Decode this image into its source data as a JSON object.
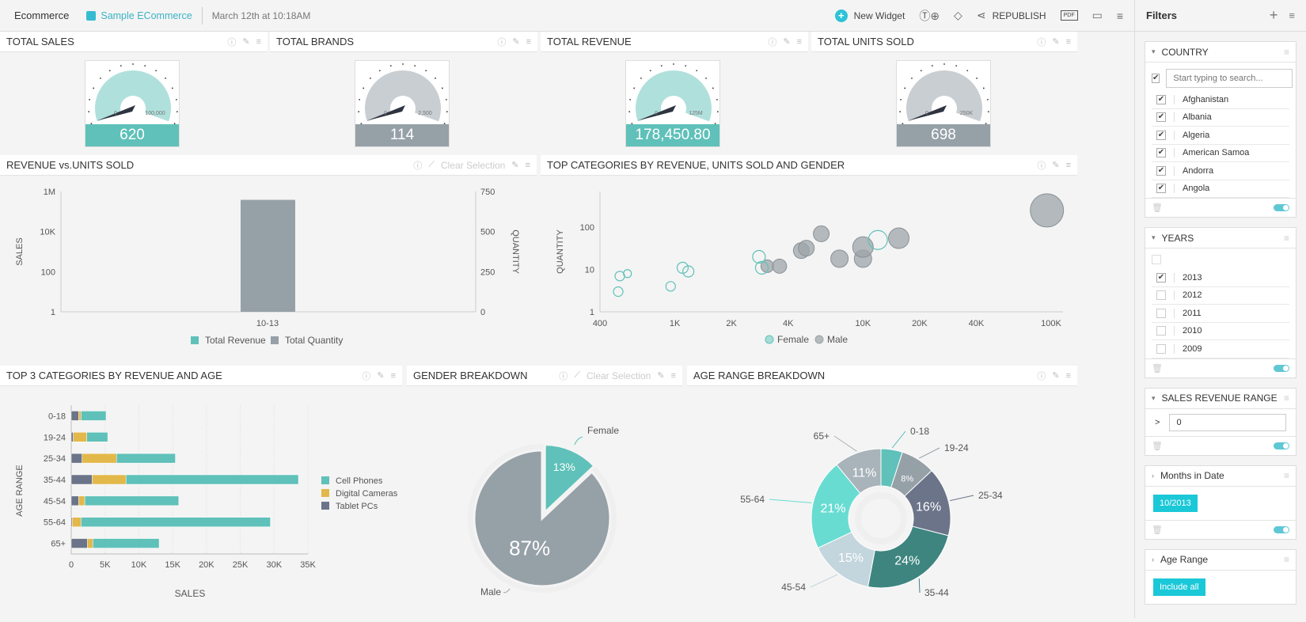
{
  "topbar": {
    "app": "Ecommerce",
    "crumb": "Sample ECommerce",
    "date": "March 12th at 10:18AM",
    "new_widget": "New Widget",
    "republish": "REPUBLISH",
    "pdf": "PDF"
  },
  "kpis": [
    {
      "title": "TOTAL SALES",
      "value": "620",
      "min": "0",
      "max": "100,000",
      "color": "#5fc1b9",
      "fill": "#b0e0dc"
    },
    {
      "title": "TOTAL BRANDS",
      "value": "114",
      "min": "0",
      "max": "2,500",
      "color": "#96a0a7",
      "fill": "#c9ced2"
    },
    {
      "title": "TOTAL REVENUE",
      "value": "178,450.80",
      "min": "0",
      "max": "125M",
      "color": "#5fc1b9",
      "fill": "#b0e0dc"
    },
    {
      "title": "TOTAL UNITS SOLD",
      "value": "698",
      "min": "0",
      "max": "250K",
      "color": "#96a0a7",
      "fill": "#c9ced2"
    }
  ],
  "widgets": {
    "rev_units": {
      "title": "REVENUE vs.UNITS SOLD",
      "clear": "Clear Selection"
    },
    "top_cat": {
      "title": "TOP CATEGORIES BY REVENUE, UNITS SOLD AND GENDER"
    },
    "top3": {
      "title": "TOP 3 CATEGORIES BY REVENUE AND AGE"
    },
    "gender": {
      "title": "GENDER BREAKDOWN",
      "clear": "Clear Selection"
    },
    "age": {
      "title": "AGE RANGE BREAKDOWN"
    }
  },
  "chart_data": [
    {
      "type": "bar",
      "title": "REVENUE vs.UNITS SOLD",
      "categories": [
        "10-13"
      ],
      "series": [
        {
          "name": "Total Revenue",
          "axis": "left",
          "values": [
            178450.8
          ],
          "color": "#5fc1b9"
        },
        {
          "name": "Total Quantity",
          "axis": "right",
          "values": [
            698
          ],
          "color": "#96a0a7"
        }
      ],
      "ylabel": "SALES",
      "y2label": "QUANTITY",
      "yticks": [
        "1",
        "100",
        "10K",
        "1M"
      ],
      "y2ticks": [
        "0",
        "250",
        "500",
        "750"
      ],
      "y2lim": [
        0,
        750
      ],
      "legend": "bottom"
    },
    {
      "type": "scatter",
      "title": "TOP CATEGORIES BY REVENUE, UNITS SOLD AND GENDER",
      "xlabel": "",
      "ylabel": "QUANTITY",
      "xticks": [
        "400",
        "1K",
        "2K",
        "4K",
        "10K",
        "20K",
        "40K",
        "100K"
      ],
      "yticks": [
        "1",
        "10",
        "100"
      ],
      "xscale": "log",
      "yscale": "log",
      "series": [
        {
          "name": "Female",
          "color": "#5fc1b9",
          "points": [
            [
              500,
              3,
              6
            ],
            [
              510,
              7,
              6
            ],
            [
              560,
              8,
              5
            ],
            [
              950,
              4,
              6
            ],
            [
              1100,
              11,
              7
            ],
            [
              1180,
              9,
              7
            ],
            [
              2800,
              20,
              8
            ],
            [
              2900,
              11,
              8
            ],
            [
              12000,
              50,
              12
            ]
          ]
        },
        {
          "name": "Male",
          "color": "#9ea5aa",
          "points": [
            [
              3100,
              12,
              8
            ],
            [
              3600,
              12,
              9
            ],
            [
              4700,
              28,
              10
            ],
            [
              5000,
              32,
              10
            ],
            [
              6000,
              70,
              10
            ],
            [
              7500,
              18,
              11
            ],
            [
              10000,
              18,
              11
            ],
            [
              10000,
              34,
              13
            ],
            [
              15500,
              55,
              13
            ],
            [
              95000,
              250,
              21
            ]
          ]
        }
      ],
      "legend": "bottom"
    },
    {
      "type": "bar",
      "orientation": "horizontal",
      "stacked": true,
      "title": "TOP 3 CATEGORIES BY REVENUE AND AGE",
      "xlabel": "SALES",
      "ylabel": "AGE RANGE",
      "categories": [
        "0-18",
        "19-24",
        "25-34",
        "35-44",
        "45-54",
        "55-64",
        "65+"
      ],
      "xticks": [
        "0",
        "5K",
        "10K",
        "15K",
        "20K",
        "25K",
        "30K",
        "35K"
      ],
      "xlim": [
        0,
        35000
      ],
      "series": [
        {
          "name": "Tablet PCs",
          "color": "#6b7489",
          "values": [
            1100,
            300,
            1600,
            3100,
            1100,
            150,
            2400
          ]
        },
        {
          "name": "Digital Cameras",
          "color": "#e3b84a",
          "values": [
            350,
            2000,
            5100,
            5000,
            900,
            1300,
            800
          ]
        },
        {
          "name": "Cell Phones",
          "color": "#5fc1b9",
          "values": [
            3700,
            3100,
            8700,
            25500,
            13900,
            28000,
            9800
          ]
        }
      ],
      "legend_order": [
        "Cell Phones",
        "Digital Cameras",
        "Tablet PCs"
      ],
      "legend": "right"
    },
    {
      "type": "pie",
      "title": "GENDER BREAKDOWN",
      "slices": [
        {
          "label": "Female",
          "value": 13,
          "text": "13%",
          "color": "#5fc1b9"
        },
        {
          "label": "Male",
          "value": 87,
          "text": "87%",
          "color": "#96a0a7"
        }
      ]
    },
    {
      "type": "pie",
      "donut": true,
      "title": "AGE RANGE BREAKDOWN",
      "slices": [
        {
          "label": "0-18",
          "value": 5,
          "text": "",
          "color": "#5fc1b9"
        },
        {
          "label": "19-24",
          "value": 8,
          "text": "8%",
          "color": "#96a0a7"
        },
        {
          "label": "25-34",
          "value": 16,
          "text": "16%",
          "color": "#6b7489"
        },
        {
          "label": "35-44",
          "value": 24,
          "text": "24%",
          "color": "#3e8580"
        },
        {
          "label": "45-54",
          "value": 15,
          "text": "15%",
          "color": "#c3d5dd"
        },
        {
          "label": "55-64",
          "value": 21,
          "text": "21%",
          "color": "#69dcd2"
        },
        {
          "label": "65+",
          "value": 11,
          "text": "11%",
          "color": "#a9b3ba"
        }
      ]
    }
  ],
  "filters": {
    "title": "Filters",
    "country": {
      "label": "COUNTRY",
      "placeholder": "Start typing to search...",
      "items": [
        "Afghanistan",
        "Albania",
        "Algeria",
        "American Samoa",
        "Andorra",
        "Angola"
      ]
    },
    "years": {
      "label": "YEARS",
      "items": [
        {
          "label": "2013",
          "checked": true
        },
        {
          "label": "2012",
          "checked": false
        },
        {
          "label": "2011",
          "checked": false
        },
        {
          "label": "2010",
          "checked": false
        },
        {
          "label": "2009",
          "checked": false
        }
      ]
    },
    "sales": {
      "label": "SALES REVENUE RANGE",
      "op": ">",
      "value": "0"
    },
    "months": {
      "label": "Months in Date",
      "chip": "10/2013"
    },
    "age": {
      "label": "Age Range",
      "chip": "Include all"
    }
  }
}
